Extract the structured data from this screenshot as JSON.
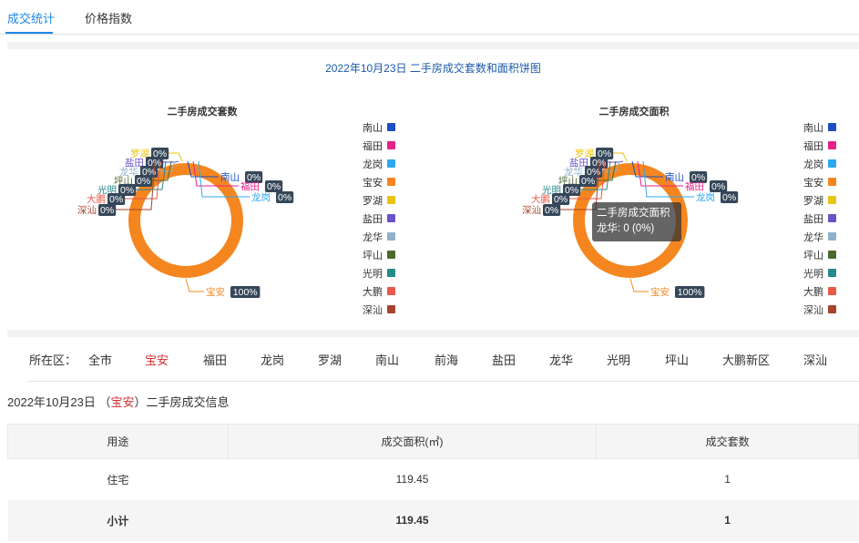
{
  "tabs": [
    {
      "label": "成交统计",
      "active": true
    },
    {
      "label": "价格指数",
      "active": false
    }
  ],
  "chart_title": "2022年10月23日 二手房成交套数和面积饼图",
  "colors": {
    "accent": "#1e88e5",
    "selected": "#d32f2f",
    "title": "#1a5aa8"
  },
  "chart_data": [
    {
      "type": "pie",
      "title": "二手房成交套数",
      "legend_position": "right",
      "slices": [
        {
          "name": "南山",
          "value": 0,
          "label": "0%",
          "color": "#1c4fc4"
        },
        {
          "name": "福田",
          "value": 0,
          "label": "0%",
          "color": "#e62189"
        },
        {
          "name": "龙岗",
          "value": 0,
          "label": "0%",
          "color": "#2ea7f0"
        },
        {
          "name": "宝安",
          "value": 1,
          "label": "100%",
          "color": "#f5861f"
        },
        {
          "name": "罗湖",
          "value": 0,
          "label": "0%",
          "color": "#e8c40e"
        },
        {
          "name": "盐田",
          "value": 0,
          "label": "0%",
          "color": "#6b52c9"
        },
        {
          "name": "龙华",
          "value": 0,
          "label": "0%",
          "color": "#8fb1c9"
        },
        {
          "name": "坪山",
          "value": 0,
          "label": "0%",
          "color": "#4a6a2e"
        },
        {
          "name": "光明",
          "value": 0,
          "label": "0%",
          "color": "#26898c"
        },
        {
          "name": "大鹏",
          "value": 0,
          "label": "0%",
          "color": "#e85a4a"
        },
        {
          "name": "深汕",
          "value": 0,
          "label": "0%",
          "color": "#a8432e"
        }
      ]
    },
    {
      "type": "pie",
      "title": "二手房成交面积",
      "legend_position": "right",
      "slices": [
        {
          "name": "南山",
          "value": 0,
          "label": "0%",
          "color": "#1c4fc4"
        },
        {
          "name": "福田",
          "value": 0,
          "label": "0%",
          "color": "#e62189"
        },
        {
          "name": "龙岗",
          "value": 0,
          "label": "0%",
          "color": "#2ea7f0"
        },
        {
          "name": "宝安",
          "value": 119.45,
          "label": "100%",
          "color": "#f5861f"
        },
        {
          "name": "罗湖",
          "value": 0,
          "label": "0%",
          "color": "#e8c40e"
        },
        {
          "name": "盐田",
          "value": 0,
          "label": "0%",
          "color": "#6b52c9"
        },
        {
          "name": "龙华",
          "value": 0,
          "label": "0%",
          "color": "#8fb1c9"
        },
        {
          "name": "坪山",
          "value": 0,
          "label": "0%",
          "color": "#4a6a2e"
        },
        {
          "name": "光明",
          "value": 0,
          "label": "0%",
          "color": "#26898c"
        },
        {
          "name": "大鹏",
          "value": 0,
          "label": "0%",
          "color": "#e85a4a"
        },
        {
          "name": "深汕",
          "value": 0,
          "label": "0%",
          "color": "#a8432e"
        }
      ]
    }
  ],
  "tooltip": {
    "title": "二手房成交面积",
    "text": "龙华: 0 (0%)"
  },
  "filter": {
    "label": "所在区：",
    "selected": "宝安",
    "options": [
      "全市",
      "宝安",
      "福田",
      "龙岗",
      "罗湖",
      "南山",
      "前海",
      "盐田",
      "龙华",
      "光明",
      "坪山",
      "大鹏新区",
      "深汕"
    ]
  },
  "info": {
    "date": "2022年10月23日",
    "open": "（",
    "district": "宝安",
    "close": "）",
    "suffix": "二手房成交信息"
  },
  "table": {
    "headers": [
      "用途",
      "成交面积(㎡)",
      "成交套数"
    ],
    "rows": [
      [
        "住宅",
        "119.45",
        "1"
      ]
    ],
    "subtotal": [
      "小计",
      "119.45",
      "1"
    ]
  }
}
